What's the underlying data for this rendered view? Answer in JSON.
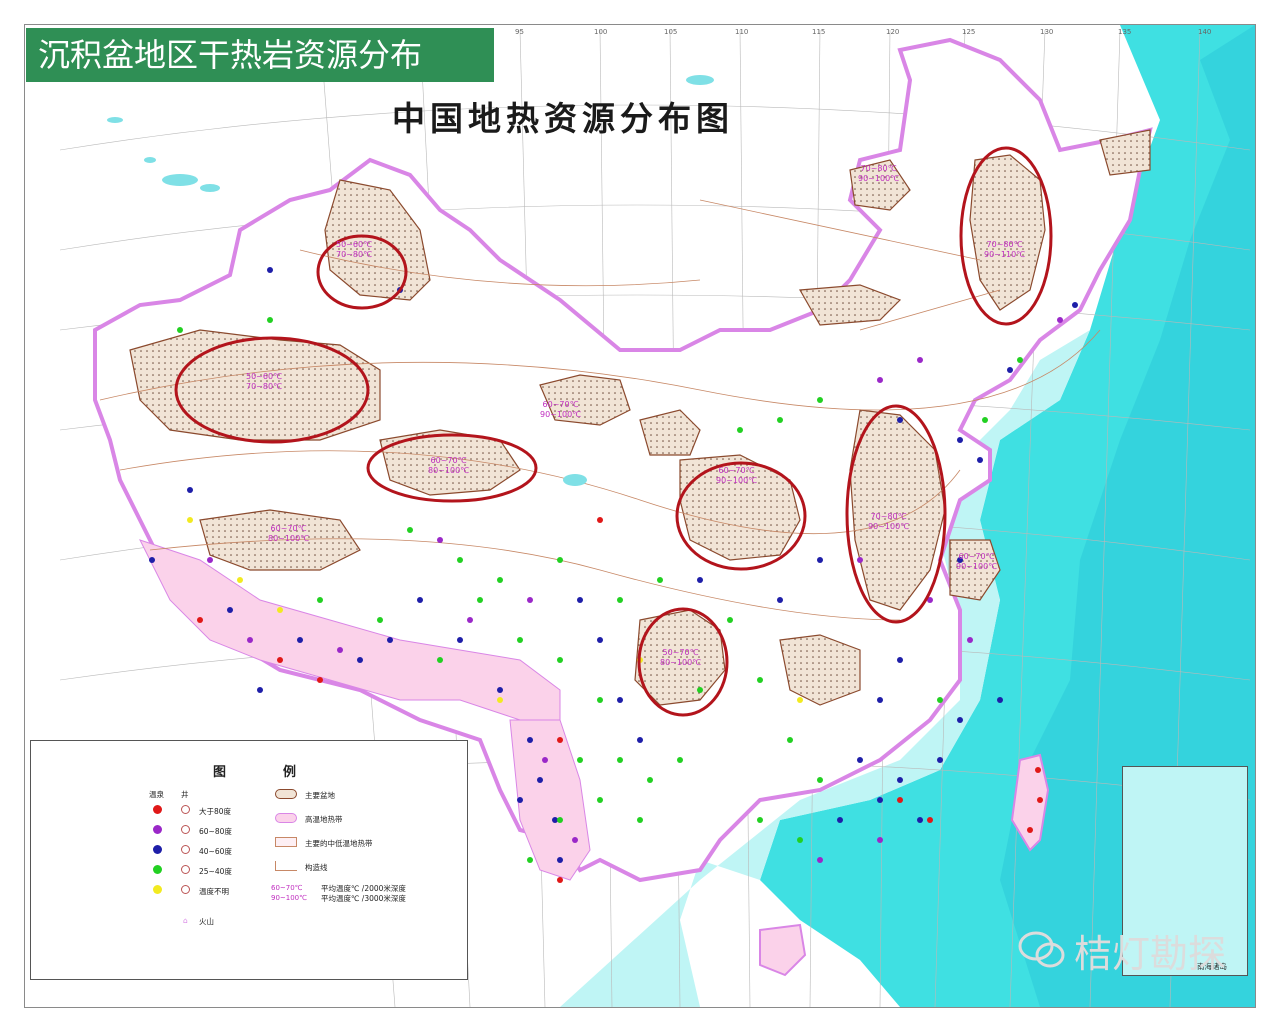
{
  "slide_title": "沉积盆地区干热岩资源分布",
  "map_title": "中国地热资源分布图",
  "coordinate_labels": [
    "95",
    "100",
    "105",
    "110",
    "115",
    "120",
    "125",
    "130",
    "135",
    "140"
  ],
  "colors": {
    "title_bar": "#2f8f55",
    "sea": "#38e0e0",
    "border": "#e08ee8",
    "basin_fill": "#f1e4d6",
    "basin_stroke": "#8b4a2e",
    "geothermal_belt": "#fbd2ea",
    "highlight_ellipse": "#b3141c",
    "temperature_text": "#c02ec0"
  },
  "basin_annotations": [
    {
      "upper": "50~60℃",
      "lower": "70~80℃"
    },
    {
      "upper": "50~60℃",
      "lower": "70~80℃"
    },
    {
      "upper": "60~70℃",
      "lower": "80~100℃"
    },
    {
      "upper": "60~70℃",
      "lower": "90~100℃"
    },
    {
      "upper": "70~80℃",
      "lower": "90~110℃"
    },
    {
      "upper": "70~80℃",
      "lower": "90~100℃"
    },
    {
      "upper": "60~70℃",
      "lower": "90~100℃"
    },
    {
      "upper": "60~70℃",
      "lower": "80~100℃"
    },
    {
      "upper": "60~70℃",
      "lower": "90~100℃"
    },
    {
      "upper": "70~80℃",
      "lower": "90~100℃"
    },
    {
      "upper": "50~70℃",
      "lower": "80~100℃"
    }
  ],
  "legend": {
    "heading_left": "图",
    "heading_right": "例",
    "col_spring": "温泉",
    "col_well": "井",
    "temperature_classes": [
      {
        "label": "大于80度",
        "color": "#e01818"
      },
      {
        "label": "60~80度",
        "color": "#9a28c8"
      },
      {
        "label": "40~60度",
        "color": "#1e1ea8"
      },
      {
        "label": "25~40度",
        "color": "#22d022"
      },
      {
        "label": "温度不明",
        "color": "#f2ea20"
      }
    ],
    "area_symbols": [
      {
        "label": "主要盆地",
        "icon": "basin-swatch"
      },
      {
        "label": "高温地热带",
        "icon": "belt-swatch"
      },
      {
        "label": "主要的中低温地热带",
        "icon": "low-belt-swatch"
      },
      {
        "label": "构造线",
        "icon": "fault-line"
      }
    ],
    "temp_pair": {
      "upper": "60~70℃",
      "lower": "90~100℃"
    },
    "temp_pair_desc": [
      "平均温度℃ /2000米深度",
      "平均温度℃ /3000米深度"
    ],
    "volcano": "火山"
  },
  "watermark": "桔灯勘探",
  "inset_caption": "南海诸岛"
}
